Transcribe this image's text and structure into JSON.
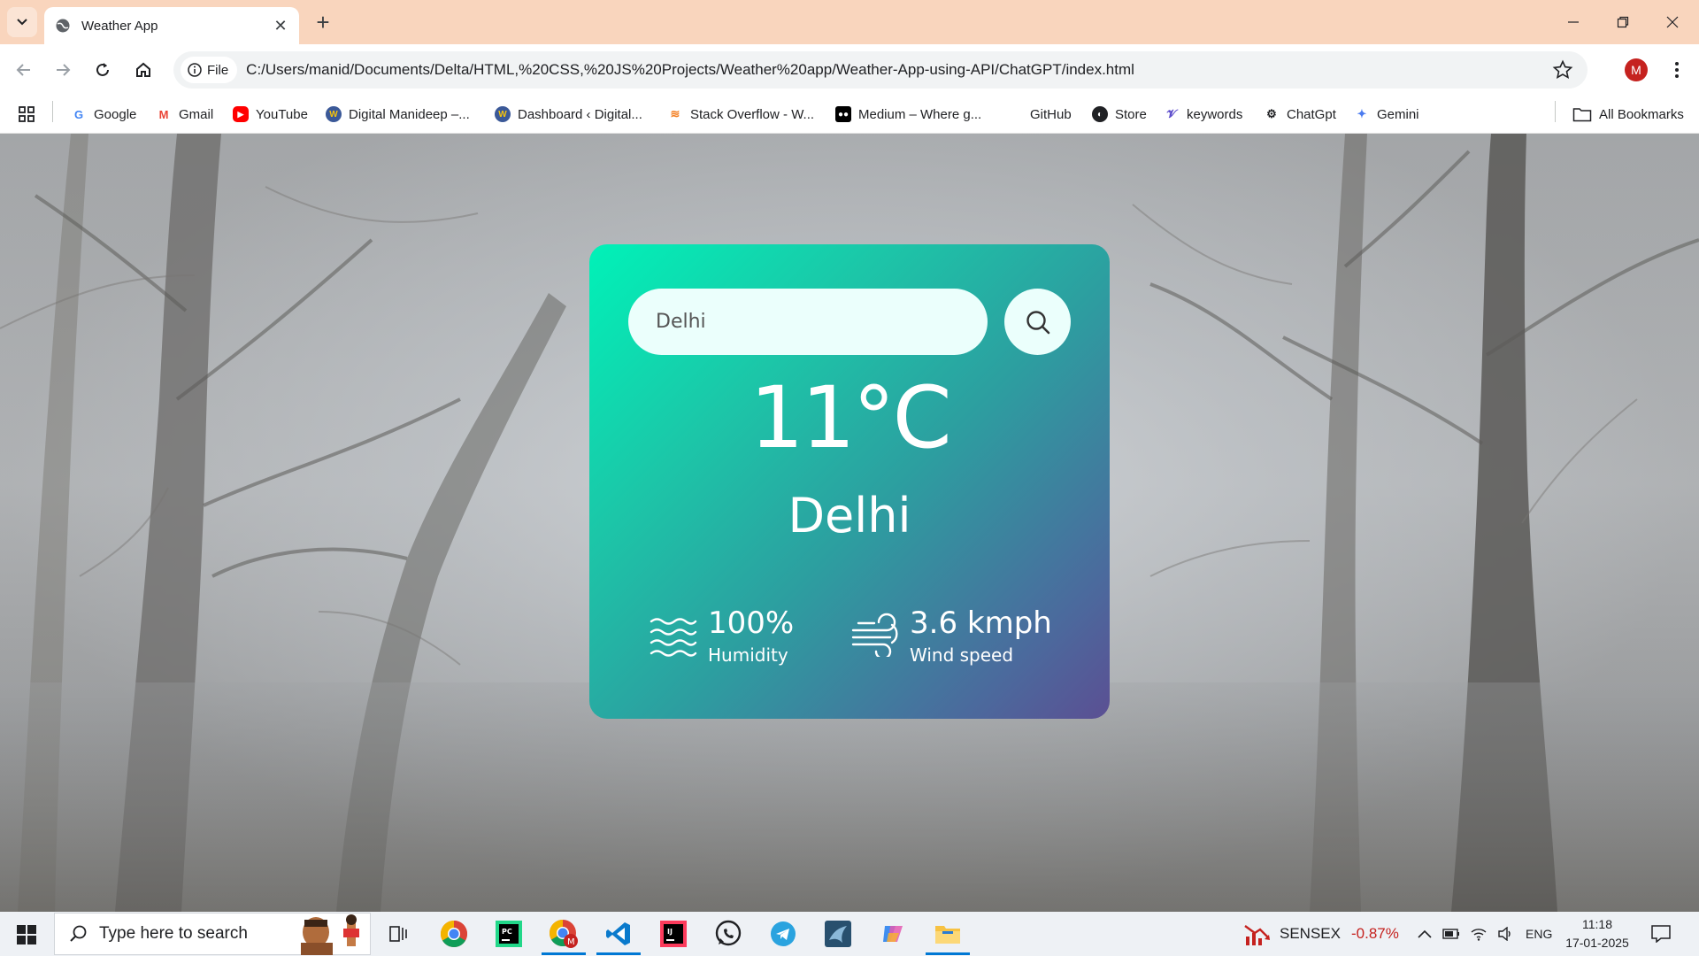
{
  "browser": {
    "tab_title": "Weather App",
    "address_chip": "File",
    "url": "C:/Users/manid/Documents/Delta/HTML,%20CSS,%20JS%20Projects/Weather%20app/Weather-App-using-API/ChatGPT/index.html",
    "profile_initial": "M"
  },
  "bookmarks": {
    "items": [
      {
        "label": "Google",
        "icon": "google-icon"
      },
      {
        "label": "Gmail",
        "icon": "gmail-icon"
      },
      {
        "label": "YouTube",
        "icon": "youtube-icon"
      },
      {
        "label": "Digital Manideep –...",
        "icon": "wordpress-icon"
      },
      {
        "label": "Dashboard ‹ Digital...",
        "icon": "wordpress-icon"
      },
      {
        "label": "Stack Overflow - W...",
        "icon": "stackoverflow-icon"
      },
      {
        "label": "Medium – Where g...",
        "icon": "medium-icon"
      },
      {
        "label": "GitHub",
        "icon": "github-icon"
      },
      {
        "label": "Store",
        "icon": "store-icon"
      },
      {
        "label": "keywords",
        "icon": "keywords-icon"
      },
      {
        "label": "ChatGpt",
        "icon": "chatgpt-icon"
      },
      {
        "label": "Gemini",
        "icon": "gemini-icon"
      }
    ],
    "all_bookmarks": "All Bookmarks"
  },
  "weather": {
    "search_value": "Delhi",
    "temperature": "11°C",
    "city": "Delhi",
    "humidity_value": "100%",
    "humidity_label": "Humidity",
    "wind_value": "3.6 kmph",
    "wind_label": "Wind speed"
  },
  "taskbar": {
    "search_placeholder": "Type here to search",
    "sensex_label": "SENSEX",
    "sensex_change": "-0.87%",
    "language": "ENG",
    "time": "11:18",
    "date": "17-01-2025"
  },
  "colors": {
    "card_gradient_start": "#00f2b8",
    "card_gradient_end": "#5b4f93",
    "titlebar": "#f9d5bd",
    "sensex_negative": "#c5221f"
  }
}
